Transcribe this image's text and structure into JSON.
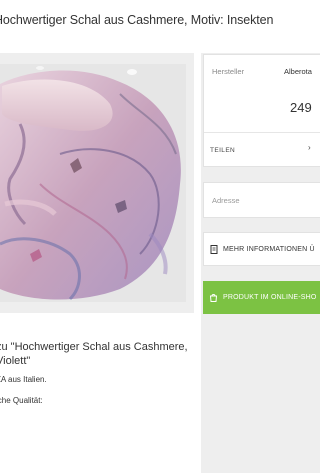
{
  "product": {
    "title": "Hochwertiger Schal aus Cashmere, Motiv: Insekten"
  },
  "image": {
    "alt": "Schal mit Insekten-Motiv in Violett"
  },
  "sidebar": {
    "manufacturer_label": "Hersteller",
    "manufacturer_value": "Alberota",
    "price": "249",
    "share_label": "TEILEN",
    "address_placeholder": "Adresse",
    "more_info_label": "MEHR INFORMATIONEN Ü",
    "shop_label": "PRODUKT IM ONLINE-SHO"
  },
  "description": {
    "heading_line1": "zu \"Hochwertiger Schal aus Cashmere,",
    "heading_line2": "Violett\"",
    "origin": "ZA aus Italien.",
    "quality": "iche Qualität:"
  },
  "colors": {
    "accent_green": "#7cc243",
    "panel_bg": "#eeeeee"
  },
  "icons": {
    "more_info": "receipt-icon",
    "shop": "shopping-bag-icon",
    "share": "chevron-icon"
  }
}
